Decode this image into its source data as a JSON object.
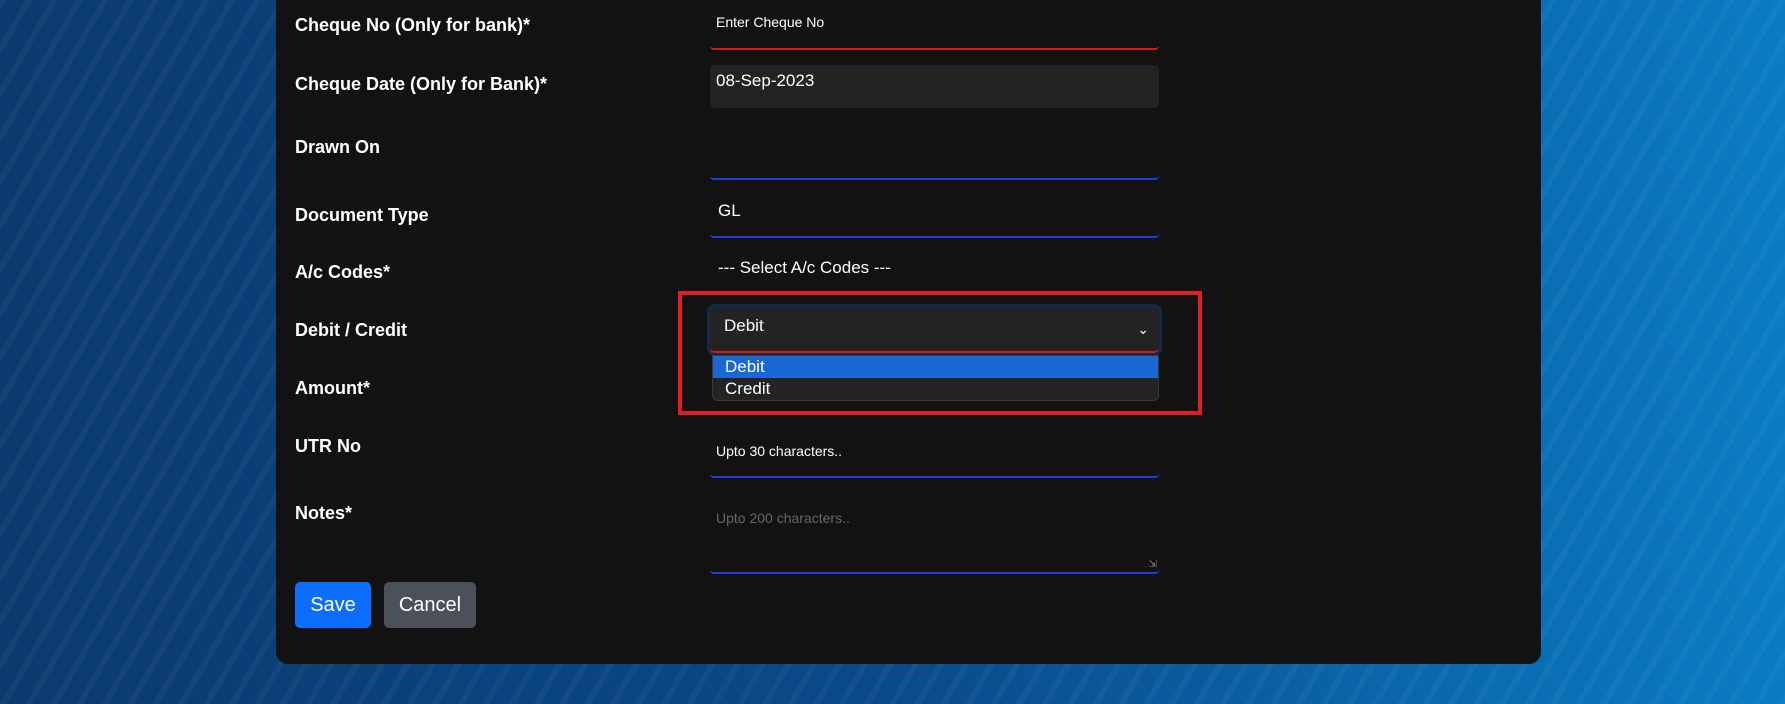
{
  "form": {
    "cheque_no": {
      "label": "Cheque No (Only for bank)*",
      "placeholder": "Enter Cheque No"
    },
    "cheque_date": {
      "label": "Cheque Date (Only for Bank)*",
      "value": "08-Sep-2023"
    },
    "drawn_on": {
      "label": "Drawn On",
      "value": ""
    },
    "document_type": {
      "label": "Document Type",
      "value": "GL"
    },
    "ac_codes": {
      "label": "A/c Codes*",
      "value": "--- Select A/c Codes ---"
    },
    "debit_credit": {
      "label": "Debit / Credit",
      "value": "Debit",
      "options": [
        "Debit",
        "Credit"
      ],
      "highlighted": "Debit"
    },
    "amount": {
      "label": "Amount*"
    },
    "utr_no": {
      "label": "UTR No",
      "placeholder": "Upto 30 characters.."
    },
    "notes": {
      "label": "Notes*",
      "placeholder": "Upto 200 characters.."
    }
  },
  "buttons": {
    "save": "Save",
    "cancel": "Cancel"
  },
  "colors": {
    "highlight_box": "#e01e26",
    "primary": "#0d6efd",
    "secondary": "#4b5158",
    "option_selected": "#1a68d4"
  }
}
